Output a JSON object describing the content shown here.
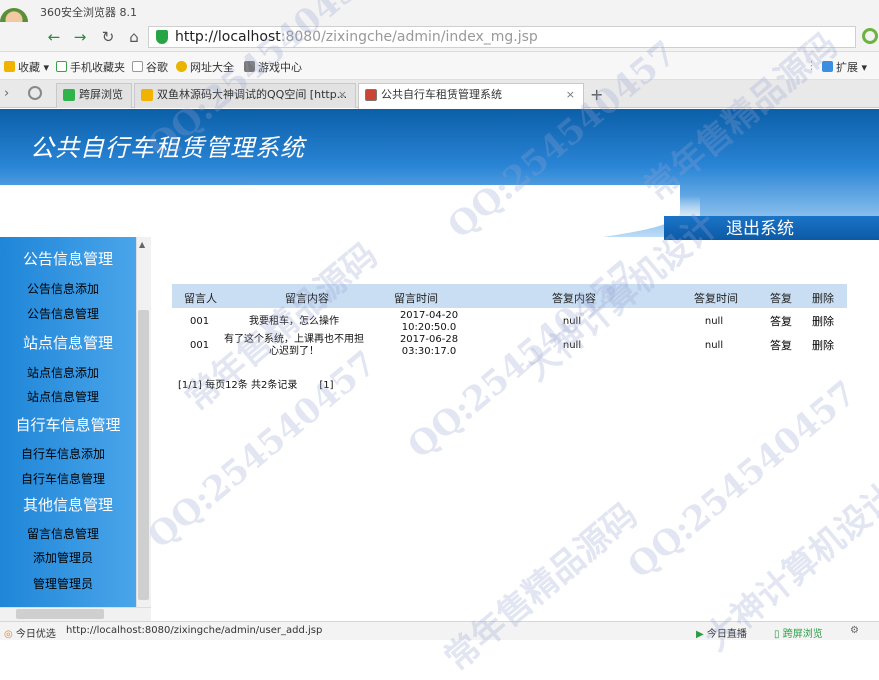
{
  "browser": {
    "app_title": "360安全浏览器 8.1",
    "url_host": "http://localhost",
    "url_rest": ":8080/zixingche/admin/index_mg.jsp",
    "bookmarks": [
      "收藏",
      "手机收藏夹",
      "谷歌",
      "网址大全",
      "游戏中心"
    ],
    "extend_label": "扩展",
    "tabs": [
      {
        "label": "跨屏浏览"
      },
      {
        "label": "双鱼林源码大神调试的QQ空间 [http..."
      },
      {
        "label": "公共自行车租赁管理系统"
      }
    ],
    "new_tab_symbol": "+"
  },
  "header": {
    "system_title": "公共自行车租赁管理系统",
    "logout_label": "退出系统"
  },
  "sidebar": {
    "groups": [
      {
        "title": "公告信息管理",
        "items": [
          "公告信息添加",
          "公告信息管理"
        ]
      },
      {
        "title": "站点信息管理",
        "items": [
          "站点信息添加",
          "站点信息管理"
        ]
      },
      {
        "title": "自行车信息管理",
        "items": [
          "自行车信息添加",
          "自行车信息管理"
        ]
      },
      {
        "title": "其他信息管理",
        "items": [
          "留言信息管理",
          "添加管理员",
          "管理管理员"
        ]
      }
    ]
  },
  "table": {
    "columns": [
      "留言人",
      "留言内容",
      "留言时间",
      "答复内容",
      "答复时间",
      "答复",
      "删除"
    ],
    "rows": [
      {
        "author": "001",
        "content_line1": "我要租车，怎么操作",
        "content_line2": "",
        "time_line1": "2017-04-20",
        "time_line2": "10:20:50.0",
        "reply": "null",
        "reply_time": "null",
        "reply_action": "答复",
        "delete_action": "删除"
      },
      {
        "author": "001",
        "content_line1": "有了这个系统，上课再也不用担",
        "content_line2": "心迟到了！",
        "time_line1": "2017-06-28",
        "time_line2": "03:30:17.0",
        "reply": "null",
        "reply_time": "null",
        "reply_action": "答复",
        "delete_action": "删除"
      }
    ],
    "pager": "[1/1] 每页12条 共2条记录",
    "pager_page": "[1]"
  },
  "statusbar": {
    "left_label": "今日优选",
    "status_url": "http://localhost:8080/zixingche/admin/user_add.jsp",
    "live_label": "今日直播",
    "cross_screen_label": "跨屏浏览"
  },
  "watermarks": [
    "QQ:254540457",
    "常年售精品源码",
    "大神计算机设计"
  ],
  "colors": {
    "banner": "#1f7ad0",
    "sidebar": "#2e8fe0",
    "table_header": "#c9def3"
  }
}
